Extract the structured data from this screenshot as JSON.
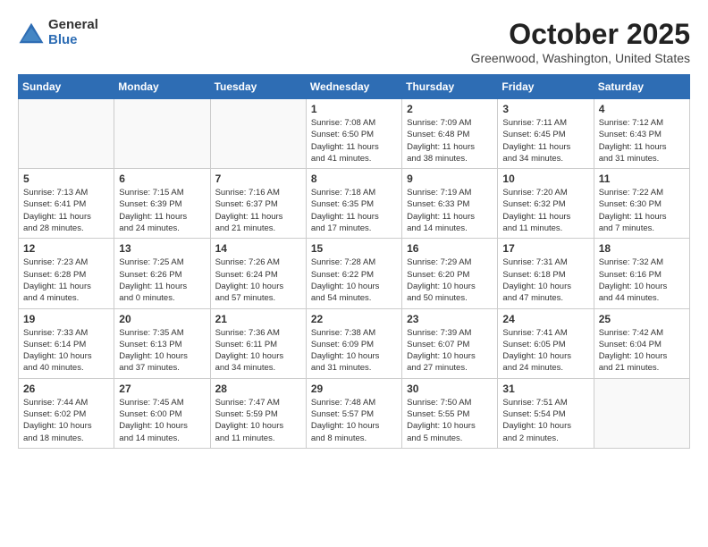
{
  "logo": {
    "general": "General",
    "blue": "Blue"
  },
  "title": "October 2025",
  "location": "Greenwood, Washington, United States",
  "weekdays": [
    "Sunday",
    "Monday",
    "Tuesday",
    "Wednesday",
    "Thursday",
    "Friday",
    "Saturday"
  ],
  "weeks": [
    [
      {
        "day": "",
        "info": ""
      },
      {
        "day": "",
        "info": ""
      },
      {
        "day": "",
        "info": ""
      },
      {
        "day": "1",
        "info": "Sunrise: 7:08 AM\nSunset: 6:50 PM\nDaylight: 11 hours\nand 41 minutes."
      },
      {
        "day": "2",
        "info": "Sunrise: 7:09 AM\nSunset: 6:48 PM\nDaylight: 11 hours\nand 38 minutes."
      },
      {
        "day": "3",
        "info": "Sunrise: 7:11 AM\nSunset: 6:45 PM\nDaylight: 11 hours\nand 34 minutes."
      },
      {
        "day": "4",
        "info": "Sunrise: 7:12 AM\nSunset: 6:43 PM\nDaylight: 11 hours\nand 31 minutes."
      }
    ],
    [
      {
        "day": "5",
        "info": "Sunrise: 7:13 AM\nSunset: 6:41 PM\nDaylight: 11 hours\nand 28 minutes."
      },
      {
        "day": "6",
        "info": "Sunrise: 7:15 AM\nSunset: 6:39 PM\nDaylight: 11 hours\nand 24 minutes."
      },
      {
        "day": "7",
        "info": "Sunrise: 7:16 AM\nSunset: 6:37 PM\nDaylight: 11 hours\nand 21 minutes."
      },
      {
        "day": "8",
        "info": "Sunrise: 7:18 AM\nSunset: 6:35 PM\nDaylight: 11 hours\nand 17 minutes."
      },
      {
        "day": "9",
        "info": "Sunrise: 7:19 AM\nSunset: 6:33 PM\nDaylight: 11 hours\nand 14 minutes."
      },
      {
        "day": "10",
        "info": "Sunrise: 7:20 AM\nSunset: 6:32 PM\nDaylight: 11 hours\nand 11 minutes."
      },
      {
        "day": "11",
        "info": "Sunrise: 7:22 AM\nSunset: 6:30 PM\nDaylight: 11 hours\nand 7 minutes."
      }
    ],
    [
      {
        "day": "12",
        "info": "Sunrise: 7:23 AM\nSunset: 6:28 PM\nDaylight: 11 hours\nand 4 minutes."
      },
      {
        "day": "13",
        "info": "Sunrise: 7:25 AM\nSunset: 6:26 PM\nDaylight: 11 hours\nand 0 minutes."
      },
      {
        "day": "14",
        "info": "Sunrise: 7:26 AM\nSunset: 6:24 PM\nDaylight: 10 hours\nand 57 minutes."
      },
      {
        "day": "15",
        "info": "Sunrise: 7:28 AM\nSunset: 6:22 PM\nDaylight: 10 hours\nand 54 minutes."
      },
      {
        "day": "16",
        "info": "Sunrise: 7:29 AM\nSunset: 6:20 PM\nDaylight: 10 hours\nand 50 minutes."
      },
      {
        "day": "17",
        "info": "Sunrise: 7:31 AM\nSunset: 6:18 PM\nDaylight: 10 hours\nand 47 minutes."
      },
      {
        "day": "18",
        "info": "Sunrise: 7:32 AM\nSunset: 6:16 PM\nDaylight: 10 hours\nand 44 minutes."
      }
    ],
    [
      {
        "day": "19",
        "info": "Sunrise: 7:33 AM\nSunset: 6:14 PM\nDaylight: 10 hours\nand 40 minutes."
      },
      {
        "day": "20",
        "info": "Sunrise: 7:35 AM\nSunset: 6:13 PM\nDaylight: 10 hours\nand 37 minutes."
      },
      {
        "day": "21",
        "info": "Sunrise: 7:36 AM\nSunset: 6:11 PM\nDaylight: 10 hours\nand 34 minutes."
      },
      {
        "day": "22",
        "info": "Sunrise: 7:38 AM\nSunset: 6:09 PM\nDaylight: 10 hours\nand 31 minutes."
      },
      {
        "day": "23",
        "info": "Sunrise: 7:39 AM\nSunset: 6:07 PM\nDaylight: 10 hours\nand 27 minutes."
      },
      {
        "day": "24",
        "info": "Sunrise: 7:41 AM\nSunset: 6:05 PM\nDaylight: 10 hours\nand 24 minutes."
      },
      {
        "day": "25",
        "info": "Sunrise: 7:42 AM\nSunset: 6:04 PM\nDaylight: 10 hours\nand 21 minutes."
      }
    ],
    [
      {
        "day": "26",
        "info": "Sunrise: 7:44 AM\nSunset: 6:02 PM\nDaylight: 10 hours\nand 18 minutes."
      },
      {
        "day": "27",
        "info": "Sunrise: 7:45 AM\nSunset: 6:00 PM\nDaylight: 10 hours\nand 14 minutes."
      },
      {
        "day": "28",
        "info": "Sunrise: 7:47 AM\nSunset: 5:59 PM\nDaylight: 10 hours\nand 11 minutes."
      },
      {
        "day": "29",
        "info": "Sunrise: 7:48 AM\nSunset: 5:57 PM\nDaylight: 10 hours\nand 8 minutes."
      },
      {
        "day": "30",
        "info": "Sunrise: 7:50 AM\nSunset: 5:55 PM\nDaylight: 10 hours\nand 5 minutes."
      },
      {
        "day": "31",
        "info": "Sunrise: 7:51 AM\nSunset: 5:54 PM\nDaylight: 10 hours\nand 2 minutes."
      },
      {
        "day": "",
        "info": ""
      }
    ]
  ]
}
